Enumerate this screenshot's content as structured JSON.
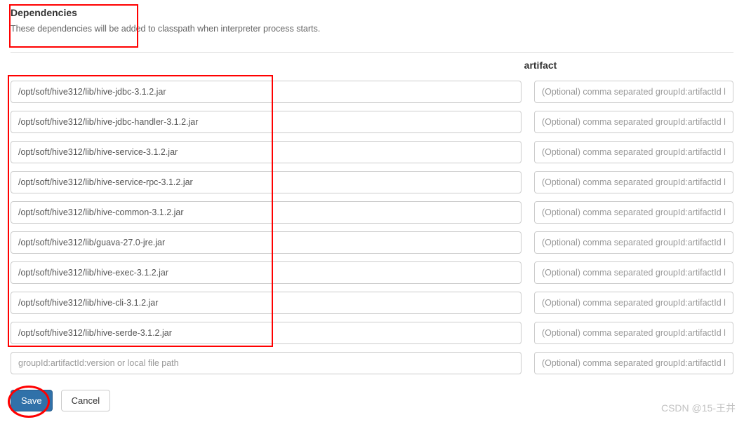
{
  "header": {
    "title": "Dependencies",
    "subtitle": "These dependencies will be added to classpath when interpreter process starts."
  },
  "columns": {
    "artifact": "artifact"
  },
  "placeholders": {
    "artifact": "groupId:artifactId:version or local file path",
    "exclude": "(Optional) comma separated groupId:artifactId list"
  },
  "dependencies": [
    {
      "artifact": "/opt/soft/hive312/lib/hive-jdbc-3.1.2.jar",
      "exclude": ""
    },
    {
      "artifact": "/opt/soft/hive312/lib/hive-jdbc-handler-3.1.2.jar",
      "exclude": ""
    },
    {
      "artifact": "/opt/soft/hive312/lib/hive-service-3.1.2.jar",
      "exclude": ""
    },
    {
      "artifact": "/opt/soft/hive312/lib/hive-service-rpc-3.1.2.jar",
      "exclude": ""
    },
    {
      "artifact": "/opt/soft/hive312/lib/hive-common-3.1.2.jar",
      "exclude": ""
    },
    {
      "artifact": "/opt/soft/hive312/lib/guava-27.0-jre.jar",
      "exclude": ""
    },
    {
      "artifact": "/opt/soft/hive312/lib/hive-exec-3.1.2.jar",
      "exclude": ""
    },
    {
      "artifact": "/opt/soft/hive312/lib/hive-cli-3.1.2.jar",
      "exclude": ""
    },
    {
      "artifact": "/opt/soft/hive312/lib/hive-serde-3.1.2.jar",
      "exclude": ""
    }
  ],
  "buttons": {
    "save": "Save",
    "cancel": "Cancel"
  },
  "watermark": "CSDN @15-王井"
}
